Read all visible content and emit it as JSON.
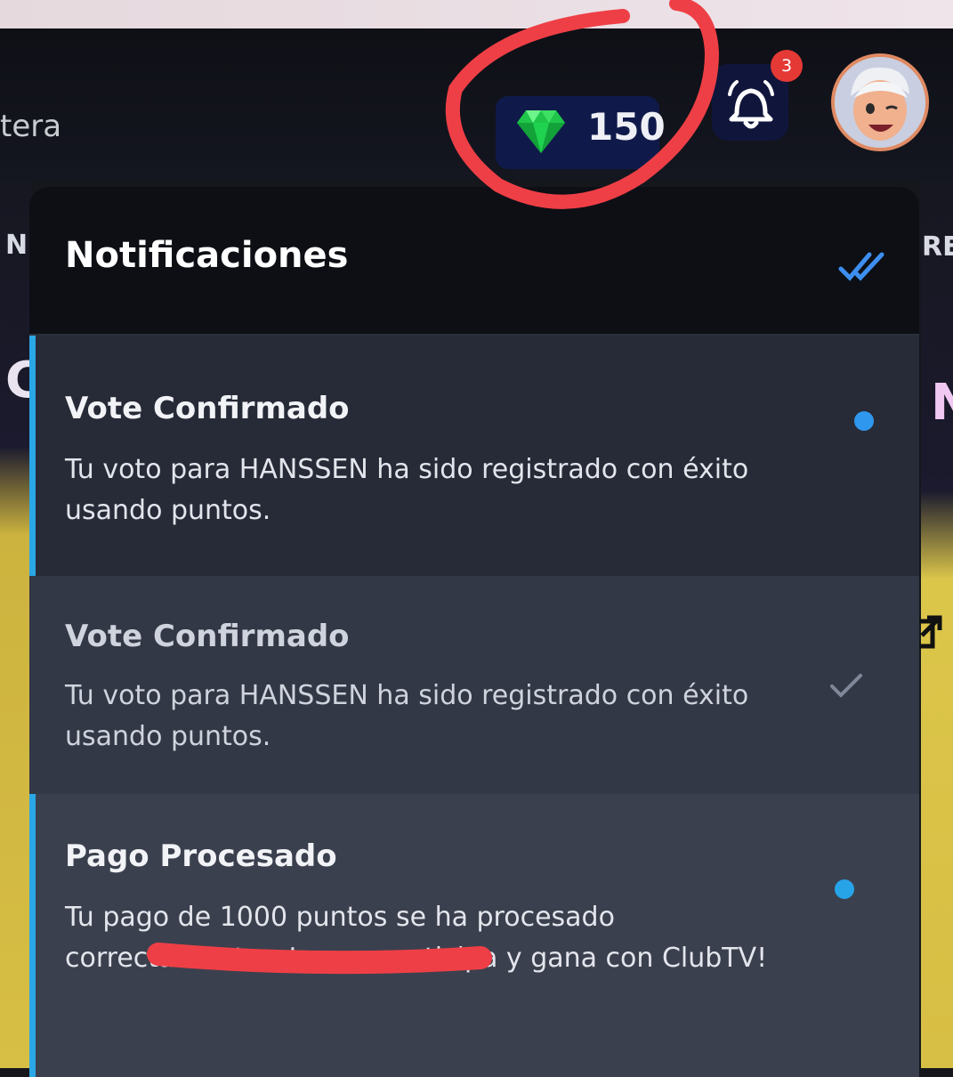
{
  "header": {
    "nav_fragment": "tera",
    "points": "150",
    "notification_count": "3"
  },
  "background": {
    "left_letter_top": "N",
    "left_letter_mid": "C",
    "right_letter_top": "RE",
    "right_letter_mid": "N"
  },
  "notifications_panel": {
    "title": "Notificaciones",
    "items": [
      {
        "title": "Vote Confirmado",
        "body": "Tu voto para HANSSEN ha sido registrado con éxito usando puntos.",
        "status": "unread"
      },
      {
        "title": "Vote Confirmado",
        "body": "Tu voto para HANSSEN ha sido registrado con éxito usando puntos.",
        "status": "read"
      },
      {
        "title": "Pago Procesado",
        "body": "Tu pago de 1000 puntos se ha procesado correctamente. ¡Juega, participa y gana con ClubTV!",
        "status": "unread"
      }
    ]
  },
  "colors": {
    "accent": "#2aa7e6",
    "badge": "#e53935",
    "points_pill": "#101a4a",
    "annotation": "#ef3f46"
  },
  "icons": [
    "gem-icon",
    "bell-icon",
    "double-check-icon",
    "check-icon",
    "external-link-icon"
  ]
}
